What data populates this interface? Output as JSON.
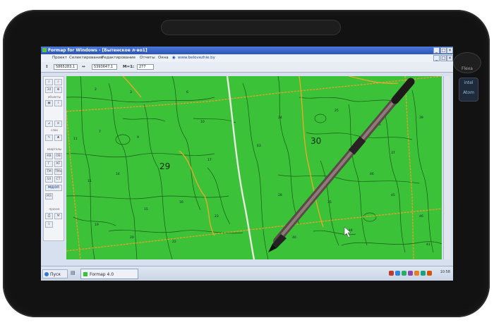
{
  "window": {
    "title": "Formap for Windows - [Бытенское л-во1]"
  },
  "menu": {
    "items": [
      "Проект",
      "Селектирование",
      "Редактирование",
      "Отчеты",
      "Окна"
    ],
    "link": "www.belovezhie.by"
  },
  "toolbar": {
    "x_value": "5865283,1",
    "y_value": "5393647,1",
    "scale_label": "M=1:",
    "scale_value": "277"
  },
  "left_panel": {
    "zoom_box": "3d",
    "section_objects": "объекты",
    "section_layers": "слои",
    "section_quarters": "кварталы",
    "section_other": "прочее",
    "btn_kv": "КВ",
    "btn_ov": "ОВ",
    "btn_g": "Г",
    "btn_kf": "КF",
    "btn_tm": "ТМ",
    "btn_tm2": "ТМн",
    "btn_sk": "SX",
    "btn_st": "СТ",
    "btn_mdop": "МДОП",
    "btn_mz": "МЗ"
  },
  "map": {
    "quarter_29": "29",
    "quarter_30": "30",
    "parcels": [
      "2",
      "3",
      "6",
      "7",
      "9",
      "10",
      "11",
      "14",
      "15",
      "16",
      "17",
      "19",
      "20",
      "22",
      "23",
      "24",
      "25",
      "26",
      "28",
      "35",
      "37",
      "39",
      "40",
      "44",
      "45",
      "46",
      "46",
      "63",
      "11",
      "41"
    ]
  },
  "taskbar": {
    "start_label": "Пуск",
    "task_label": "Formap 4.0",
    "clock": "10:58"
  },
  "device": {
    "brand": "Flexa",
    "chip": "intel Atom"
  },
  "colors": {
    "map_fill": "#3bc238",
    "parcel_lines": "#1a5a1a",
    "quarter_border": "#e8a02a",
    "titlebar": "#2b55b8"
  }
}
